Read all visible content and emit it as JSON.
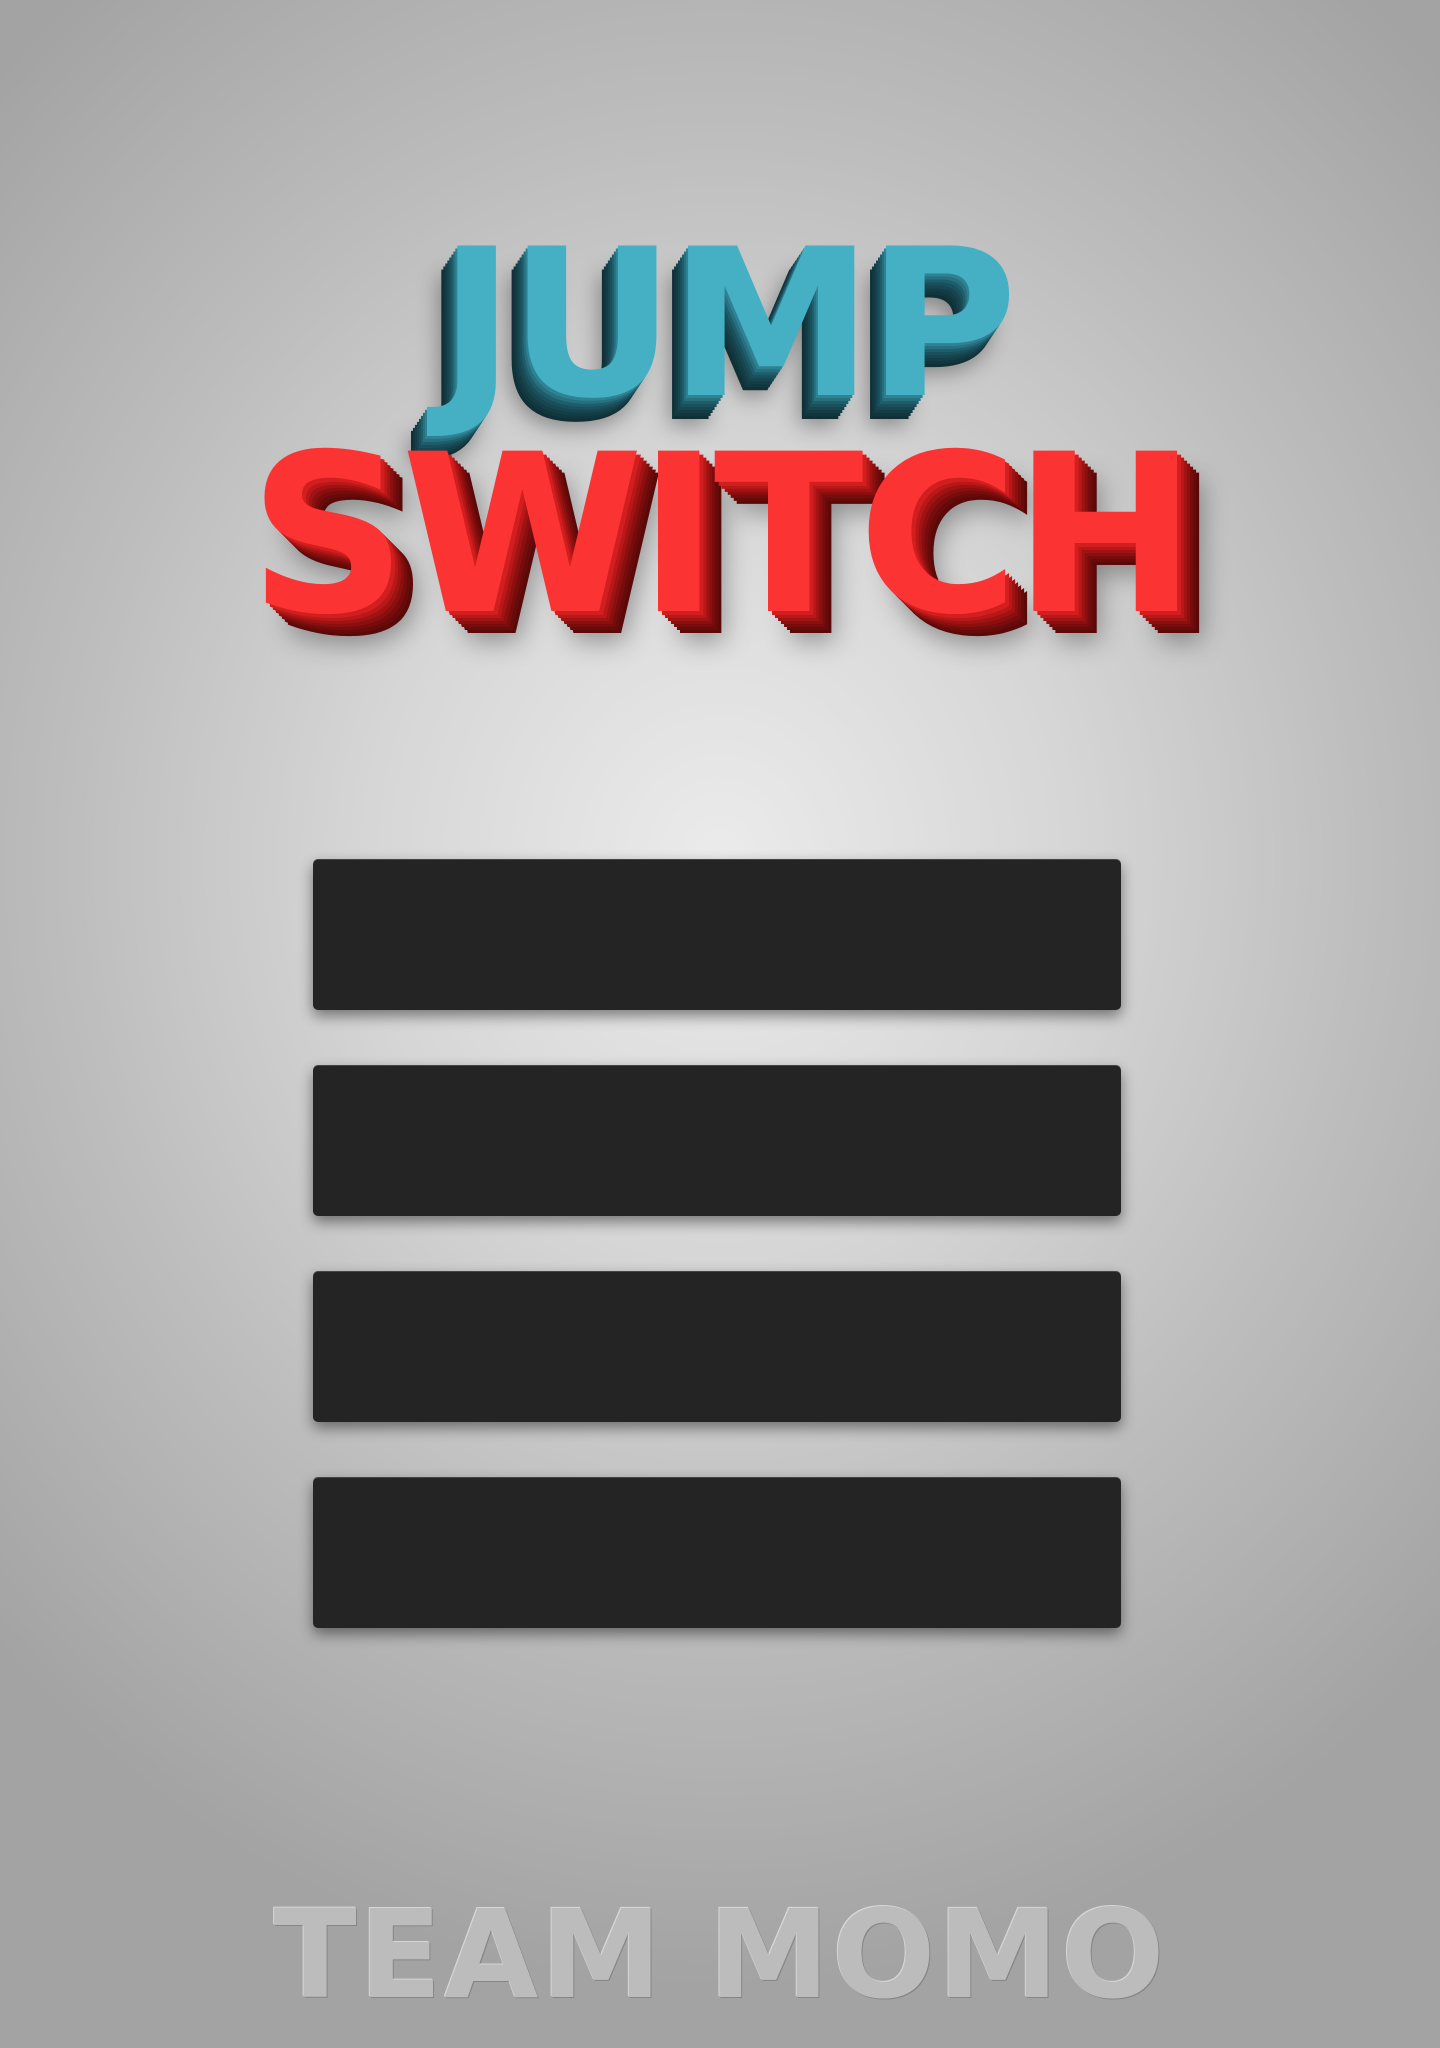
{
  "game": {
    "title": {
      "line1": "JUMP",
      "line2": "SWITCH"
    },
    "menu": {
      "items": [
        {
          "label": ""
        },
        {
          "label": ""
        },
        {
          "label": ""
        },
        {
          "label": ""
        }
      ]
    },
    "credit": "TEAM MOMO"
  },
  "colors": {
    "title_line1": "#45afc4",
    "title_line2": "#fb3333",
    "menu_button": "#242424",
    "background": "#d6d6d6"
  }
}
